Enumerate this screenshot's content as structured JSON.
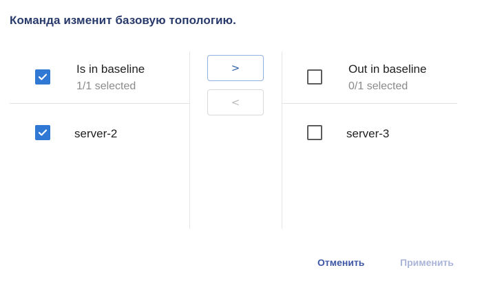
{
  "dialog": {
    "title": "Команда изменит базовую топологию."
  },
  "left_panel": {
    "header_label": "Is in baseline",
    "header_count": "1/1 selected",
    "header_checked": true,
    "items": [
      {
        "label": "server-2",
        "checked": true
      }
    ]
  },
  "right_panel": {
    "header_label": "Out in baseline",
    "header_count": "0/1 selected",
    "header_checked": false,
    "items": [
      {
        "label": "server-3",
        "checked": false
      }
    ]
  },
  "transfer": {
    "move_right_label": ">",
    "move_left_label": "<"
  },
  "footer": {
    "cancel_label": "Отменить",
    "apply_label": "Применить"
  },
  "colors": {
    "accent": "#2f78d4",
    "title": "#283a6b",
    "cancel": "#3d56a6",
    "apply_disabled": "#a9b4d8"
  }
}
